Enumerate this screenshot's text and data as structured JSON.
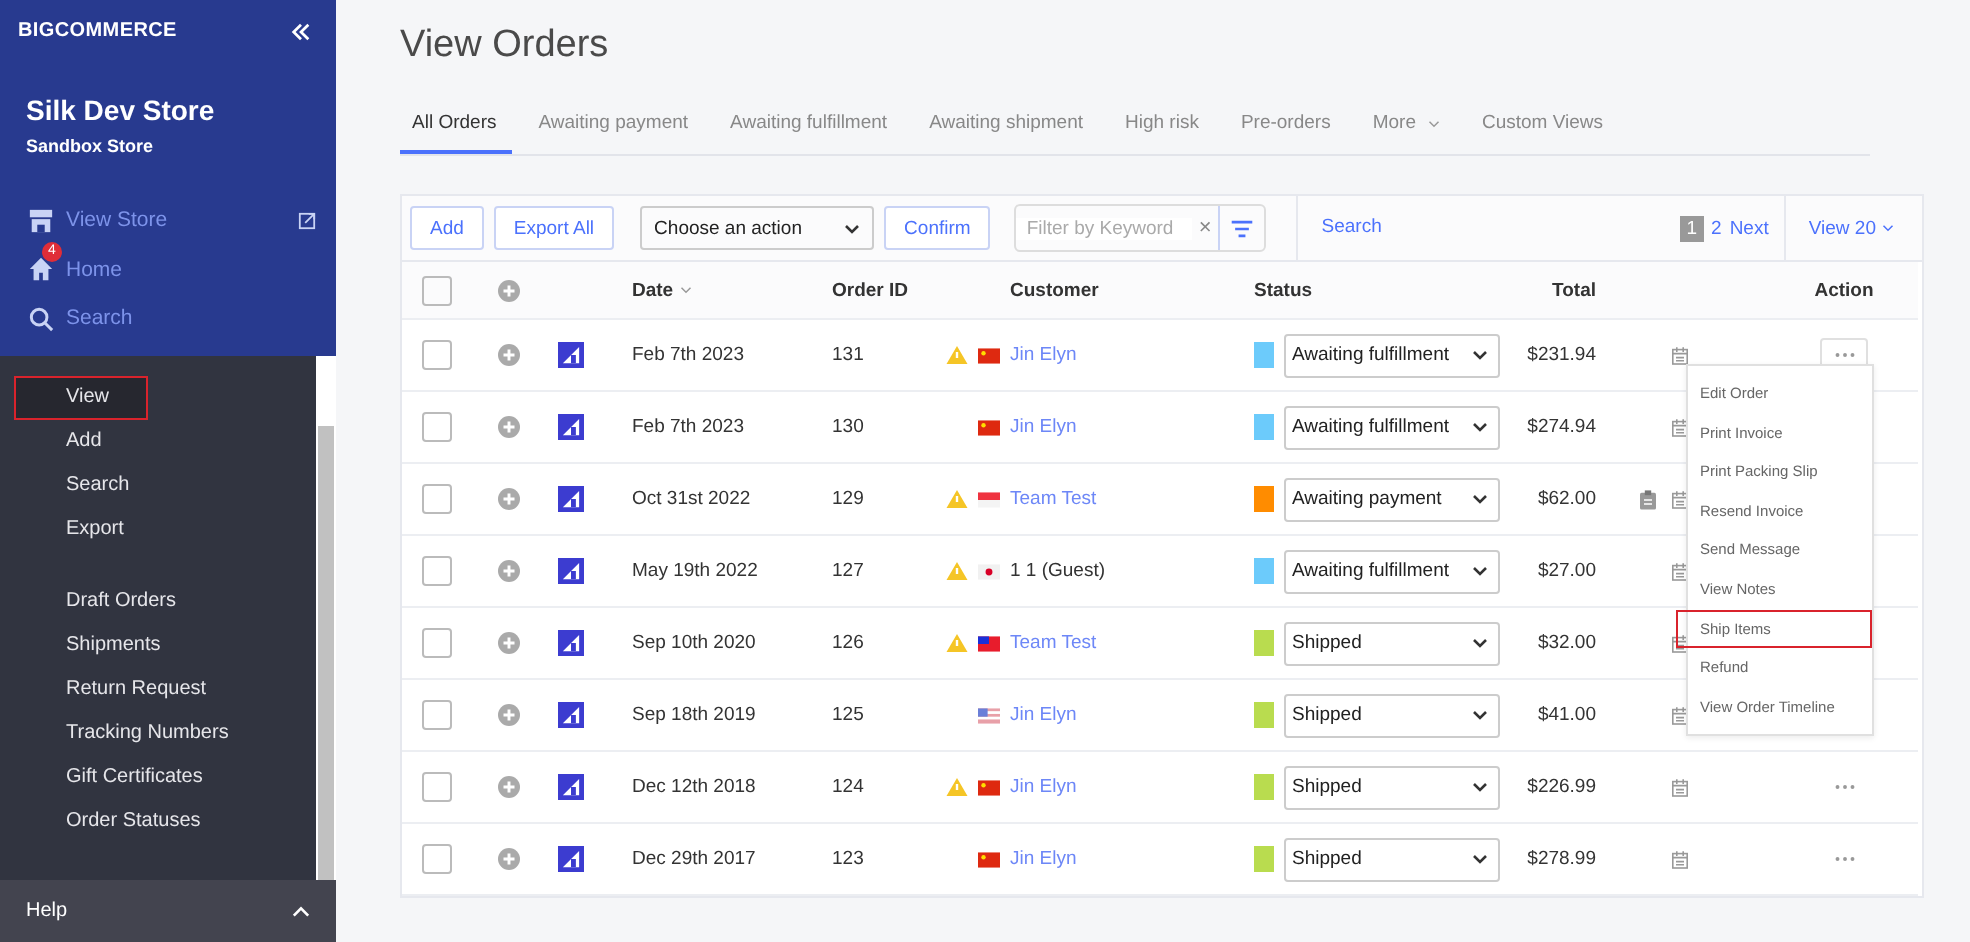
{
  "sidebar": {
    "brand": "BIGCOMMERCE",
    "store_name": "Silk Dev Store",
    "store_subtitle": "Sandbox Store",
    "top_items": [
      {
        "kind": "store",
        "label": "View Store"
      },
      {
        "kind": "home",
        "label": "Home",
        "badge": "4"
      },
      {
        "kind": "search",
        "label": "Search"
      }
    ],
    "groups": [
      [
        {
          "label": "View",
          "selected": true,
          "highlighted": true
        },
        {
          "label": "Add",
          "selected": false,
          "highlighted": false
        },
        {
          "label": "Search",
          "selected": false,
          "highlighted": false
        },
        {
          "label": "Export",
          "selected": false,
          "highlighted": false
        }
      ],
      [
        {
          "label": "Draft Orders",
          "selected": false,
          "highlighted": false
        },
        {
          "label": "Shipments",
          "selected": false,
          "highlighted": false
        },
        {
          "label": "Return Request",
          "selected": false,
          "highlighted": false
        },
        {
          "label": "Tracking Numbers",
          "selected": false,
          "highlighted": false
        },
        {
          "label": "Gift Certificates",
          "selected": false,
          "highlighted": false
        },
        {
          "label": "Order Statuses",
          "selected": false,
          "highlighted": false
        }
      ]
    ],
    "help": "Help"
  },
  "page_title": "View Orders",
  "tabs": [
    {
      "label": "All Orders",
      "selected": true,
      "dropdown": false
    },
    {
      "label": "Awaiting payment",
      "selected": false,
      "dropdown": false
    },
    {
      "label": "Awaiting fulfillment",
      "selected": false,
      "dropdown": false
    },
    {
      "label": "Awaiting shipment",
      "selected": false,
      "dropdown": false
    },
    {
      "label": "High risk",
      "selected": false,
      "dropdown": false
    },
    {
      "label": "Pre-orders",
      "selected": false,
      "dropdown": false
    },
    {
      "label": "More",
      "selected": false,
      "dropdown": true
    },
    {
      "label": "Custom Views",
      "selected": false,
      "dropdown": false
    }
  ],
  "toolbar": {
    "add": "Add",
    "export_all": "Export All",
    "action_select": "Choose an action",
    "confirm": "Confirm",
    "filter": {
      "placeholder": "Filter by Keyword",
      "clear": "×"
    },
    "search": "Search",
    "pages": [
      {
        "label": "1",
        "selected": true
      },
      {
        "label": "2",
        "selected": false
      }
    ],
    "next": "Next",
    "view": "View 20"
  },
  "table": {
    "select_all_checked": false,
    "columns": [
      "Date",
      "Order ID",
      "Customer",
      "Status",
      "Total",
      "Action"
    ],
    "rows": [
      {
        "checked": false,
        "date": "Feb 7th 2023",
        "order_id": "131",
        "warning": true,
        "flag": {
          "kind": "cn"
        },
        "customer": "Jin Elyn",
        "guest": false,
        "color": "#6ccbfb",
        "status": "Awaiting fulfillment",
        "total": "$231.94",
        "notes": false,
        "menu_open": true
      },
      {
        "checked": false,
        "date": "Feb 7th 2023",
        "order_id": "130",
        "warning": false,
        "flag": {
          "kind": "cn"
        },
        "customer": "Jin Elyn",
        "guest": false,
        "color": "#6ccbfb",
        "status": "Awaiting fulfillment",
        "total": "$274.94",
        "notes": false,
        "menu_open": false
      },
      {
        "checked": false,
        "date": "Oct 31st 2022",
        "order_id": "129",
        "warning": true,
        "flag": {
          "kind": "sg"
        },
        "customer": "Team Test",
        "guest": false,
        "color": "#ff8c00",
        "status": "Awaiting payment",
        "total": "$62.00",
        "notes": true,
        "menu_open": false
      },
      {
        "checked": false,
        "date": "May 19th 2022",
        "order_id": "127",
        "warning": true,
        "flag": {
          "kind": "jp"
        },
        "customer": "1 1 (Guest)",
        "guest": true,
        "color": "#6ccbfb",
        "status": "Awaiting fulfillment",
        "total": "$27.00",
        "notes": false,
        "menu_open": false
      },
      {
        "checked": false,
        "date": "Sep 10th 2020",
        "order_id": "126",
        "warning": true,
        "flag": {
          "kind": "tw"
        },
        "customer": "Team Test",
        "guest": false,
        "color": "#b9dc4f",
        "status": "Shipped",
        "total": "$32.00",
        "notes": false,
        "menu_open": false
      },
      {
        "checked": false,
        "date": "Sep 18th 2019",
        "order_id": "125",
        "warning": false,
        "flag": {
          "kind": "us"
        },
        "customer": "Jin Elyn",
        "guest": false,
        "color": "#b9dc4f",
        "status": "Shipped",
        "total": "$41.00",
        "notes": false,
        "menu_open": false
      },
      {
        "checked": false,
        "date": "Dec 12th 2018",
        "order_id": "124",
        "warning": true,
        "flag": {
          "kind": "cn"
        },
        "customer": "Jin Elyn",
        "guest": false,
        "color": "#b9dc4f",
        "status": "Shipped",
        "total": "$226.99",
        "notes": false,
        "menu_open": false
      },
      {
        "checked": false,
        "date": "Dec 29th 2017",
        "order_id": "123",
        "warning": false,
        "flag": {
          "kind": "cn"
        },
        "customer": "Jin Elyn",
        "guest": false,
        "color": "#b9dc4f",
        "status": "Shipped",
        "total": "$278.99",
        "notes": false,
        "menu_open": false
      }
    ]
  },
  "action_menu": [
    {
      "label": "Edit Order",
      "highlighted": false
    },
    {
      "label": "Print Invoice",
      "highlighted": false
    },
    {
      "label": "Print Packing Slip",
      "highlighted": false
    },
    {
      "label": "Resend Invoice",
      "highlighted": false
    },
    {
      "label": "Send Message",
      "highlighted": false
    },
    {
      "label": "View Notes",
      "highlighted": false
    },
    {
      "label": "Ship Items",
      "highlighted": true
    },
    {
      "label": "Refund",
      "highlighted": false
    },
    {
      "label": "View Order Timeline",
      "highlighted": false
    }
  ]
}
